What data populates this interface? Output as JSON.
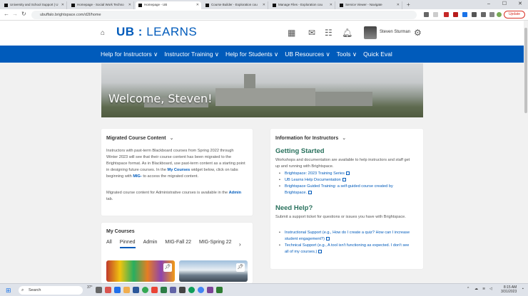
{
  "browser": {
    "tabs": [
      {
        "title": "University and School Support | U",
        "active": false
      },
      {
        "title": "Homepage - Social Work Techno",
        "active": false
      },
      {
        "title": "Homepage - UB",
        "active": true
      },
      {
        "title": "Course Builder - Exploration cou",
        "active": false
      },
      {
        "title": "Manage Files - Exploration cou",
        "active": false
      },
      {
        "title": "Service Viewer - Navigate",
        "active": false
      }
    ],
    "new_tab": "+",
    "url": "ubuffalo.brightspace.com/d2l/home",
    "update_label": "Update"
  },
  "header": {
    "logo_ub": "UB",
    "logo_sep": ":",
    "logo_learns": "LEARNS",
    "user_name": "Steven Sturman"
  },
  "menu": [
    "Help for Instructors ∨",
    "Instructor Training ∨",
    "Help for Students ∨",
    "UB Resources ∨",
    "Tools ∨",
    "Quick Eval"
  ],
  "hero": {
    "welcome": "Welcome, Steven!"
  },
  "migrated": {
    "title": "Migrated Course Content",
    "p1_a": "Instructors with past-term Blackboard courses from Spring 2022 through Winter 2023 will see that their course content has been migrated to the Brightspace format. As in Blackboard, use past-term content as a starting point in designing future courses. In the",
    "p1_link": "My Courses",
    "p1_b": "widget below, click on tabs beginning with",
    "p1_mig": "MIG-",
    "p1_c": "to access the migrated content.",
    "p2_a": "Migrated course content for Administrative courses is available in the",
    "p2_link": "Admin",
    "p2_b": "tab."
  },
  "info": {
    "title": "Information for Instructors",
    "getting_started": "Getting Started",
    "gs_text": "Workshops and documentation are available to help instructors and staff get up and running with Brightspace.",
    "gs_links": [
      "Brightspace: 2023 Training Series",
      "UB Learns Help Documentation",
      "Brightspace Guided Training: a self-guided course created by Brightspace."
    ],
    "need_help": "Need Help?",
    "nh_text": "Submit a support ticket for questions or issues you have with Brightspace.",
    "nh_links": [
      "Instructional Support (e.g., How do I create a quiz? How can I increase student engagement?)",
      "Technical Support (e.g., A tool isn't functioning as expected. I don't see all of my courses.)"
    ]
  },
  "courses": {
    "title": "My Courses",
    "tabs": [
      "All",
      "Pinned",
      "Admin",
      "MIG-Fall 22",
      "MIG-Spring 22"
    ],
    "selected_tab": "Pinned"
  },
  "taskbar": {
    "search_label": "Search",
    "temp": "37°",
    "time": "8:15 AM",
    "date": "3/31/2023"
  }
}
